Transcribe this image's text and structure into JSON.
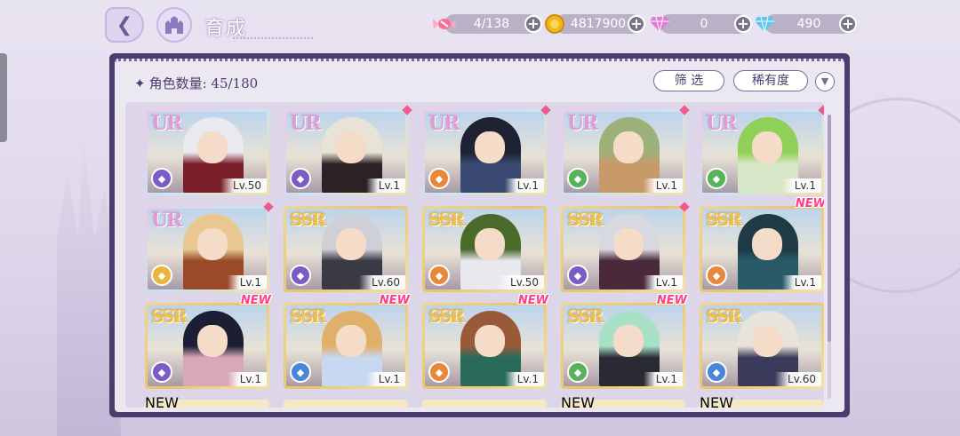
{
  "header": {
    "title": "育成",
    "resources": [
      {
        "name": "stamina",
        "icon": "candy-icon",
        "value": "4/138"
      },
      {
        "name": "gold",
        "icon": "gold-coin-icon",
        "value": "4817900"
      },
      {
        "name": "paid-gem",
        "icon": "pink-diamond-icon",
        "value": "0"
      },
      {
        "name": "free-gem",
        "icon": "blue-diamond-icon",
        "value": "490"
      }
    ]
  },
  "panel": {
    "count_label": "角色数量: 45/180",
    "filter_label": "筛 选",
    "rarity_label": "稀有度"
  },
  "colors": {
    "attr_purple": "#7b5cc4",
    "attr_yellow": "#e7b63a",
    "attr_orange": "#e8883a",
    "attr_green": "#58b25a",
    "attr_blue": "#4a86d6",
    "new_tag": "#ff3f86"
  },
  "cards": [
    {
      "rarity": "UR",
      "level": "Lv.50",
      "attr": "purple",
      "new": false,
      "gem": false,
      "hair": "#e9e9ef",
      "outfit": "#7a1e2a"
    },
    {
      "rarity": "UR",
      "level": "Lv.1",
      "attr": "purple",
      "new": false,
      "gem": true,
      "hair": "#e8e3d6",
      "outfit": "#2c2226"
    },
    {
      "rarity": "UR",
      "level": "Lv.1",
      "attr": "orange",
      "new": false,
      "gem": true,
      "hair": "#1e2232",
      "outfit": "#3a4a72"
    },
    {
      "rarity": "UR",
      "level": "Lv.1",
      "attr": "green",
      "new": false,
      "gem": true,
      "hair": "#9cb07a",
      "outfit": "#c89a6a"
    },
    {
      "rarity": "UR",
      "level": "Lv.1",
      "attr": "green",
      "new": false,
      "gem": true,
      "hair": "#8fd058",
      "outfit": "#d8e6c8"
    },
    {
      "rarity": "UR",
      "level": "Lv.1",
      "attr": "yellow",
      "new": false,
      "gem": true,
      "hair": "#e8c890",
      "outfit": "#9a4a2a"
    },
    {
      "rarity": "SSR",
      "level": "Lv.60",
      "attr": "purple",
      "new": false,
      "gem": false,
      "hair": "#cfcfd8",
      "outfit": "#3a3a44"
    },
    {
      "rarity": "SSR",
      "level": "Lv.50",
      "attr": "orange",
      "new": false,
      "gem": false,
      "hair": "#4a6a2a",
      "outfit": "#e8e8ee"
    },
    {
      "rarity": "SSR",
      "level": "Lv.1",
      "attr": "purple",
      "new": false,
      "gem": true,
      "hair": "#d8d8e0",
      "outfit": "#4a2a3a"
    },
    {
      "rarity": "SSR",
      "level": "Lv.1",
      "attr": "orange",
      "new": true,
      "gem": false,
      "hair": "#1e3a44",
      "outfit": "#2a5a6a"
    },
    {
      "rarity": "SSR",
      "level": "Lv.1",
      "attr": "purple",
      "new": true,
      "gem": false,
      "hair": "#1c1e34",
      "outfit": "#d8a8b8"
    },
    {
      "rarity": "SSR",
      "level": "Lv.1",
      "attr": "blue",
      "new": true,
      "gem": false,
      "hair": "#e0b06a",
      "outfit": "#c8d8f0"
    },
    {
      "rarity": "SSR",
      "level": "Lv.1",
      "attr": "orange",
      "new": true,
      "gem": false,
      "hair": "#9a5a3a",
      "outfit": "#2a6a5a"
    },
    {
      "rarity": "SSR",
      "level": "Lv.1",
      "attr": "green",
      "new": true,
      "gem": false,
      "hair": "#a8e0c8",
      "outfit": "#2a2a34"
    },
    {
      "rarity": "SSR",
      "level": "Lv.60",
      "attr": "blue",
      "new": false,
      "gem": false,
      "hair": "#e8e4dc",
      "outfit": "#3a3a5a"
    }
  ],
  "partial_row_new_tags": [
    true,
    false,
    false,
    true,
    true
  ],
  "new_tag_label": "NEW"
}
